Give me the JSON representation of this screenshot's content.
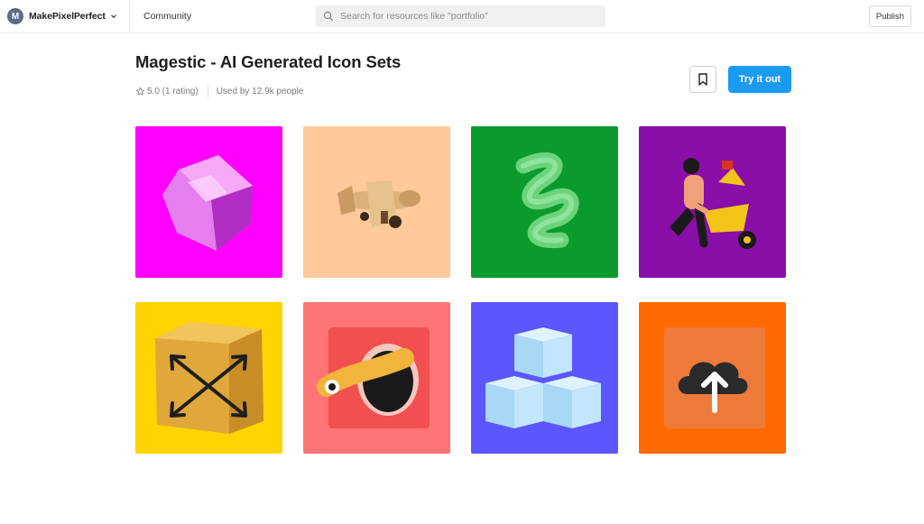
{
  "header": {
    "team_initial": "M",
    "team_name": "MakePixelPerfect",
    "community_label": "Community",
    "search_placeholder": "Search for resources like \"portfolio\"",
    "publish_label": "Publish"
  },
  "resource": {
    "title": "Magestic - AI Generated Icon Sets",
    "rating": "5.0 (1 rating)",
    "usage": "Used by 12.9k people",
    "try_label": "Try it out"
  },
  "colors": {
    "accent": "#1b9bf0",
    "tiles": [
      "#ff00ff",
      "#ffc99a",
      "#0b9a2e",
      "#8a0ea8",
      "#ffd400",
      "#ff7575",
      "#5b56ff",
      "#ff6a00"
    ]
  },
  "gallery": [
    {
      "icon": "pink-crystal-gem-icon"
    },
    {
      "icon": "wooden-airplane-icon"
    },
    {
      "icon": "green-squiggle-icon"
    },
    {
      "icon": "wheelbarrow-figure-icon"
    },
    {
      "icon": "expand-arrows-box-icon"
    },
    {
      "icon": "worm-in-hole-icon"
    },
    {
      "icon": "glass-cubes-icon"
    },
    {
      "icon": "cloud-upload-icon"
    }
  ]
}
